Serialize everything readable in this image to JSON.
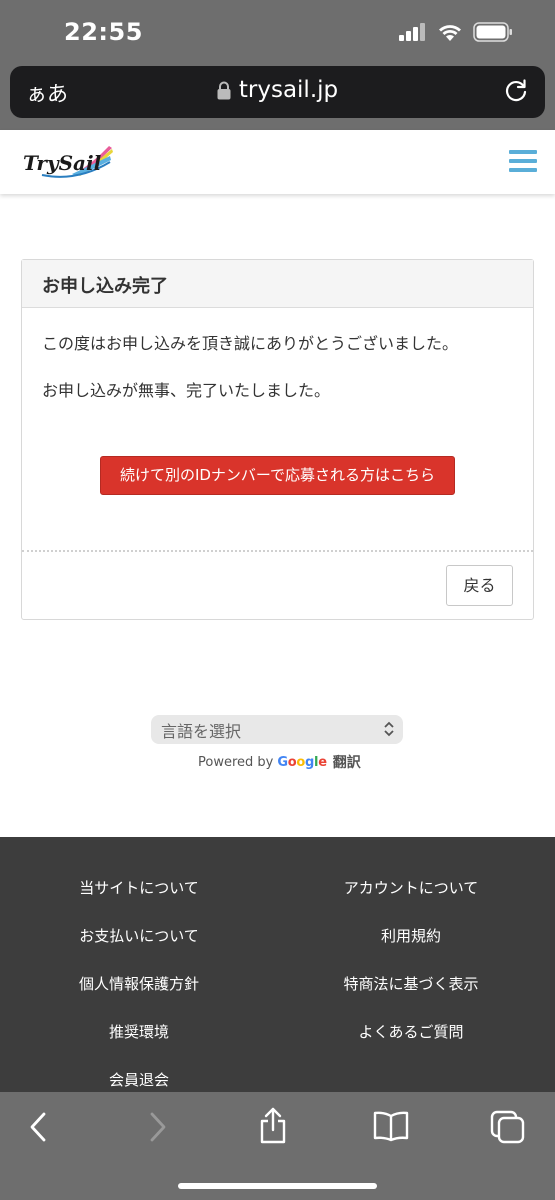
{
  "status_bar": {
    "time": "22:55"
  },
  "url_bar": {
    "aa_label": "ぁあ",
    "domain": "trysail.jp"
  },
  "header": {
    "logo_text": "TrySail"
  },
  "panel": {
    "heading": "お申し込み完了",
    "message1": "この度はお申し込みを頂き誠にありがとうございました。",
    "message2": "お申し込みが無事、完了いたしました。",
    "continue_button": "続けて別のIDナンバーで応募される方はこちら",
    "back_button": "戻る"
  },
  "translate": {
    "select_placeholder": "言語を選択",
    "powered_by": "Powered by",
    "google": "Google",
    "translate_label": "翻訳"
  },
  "footer": {
    "links": [
      "当サイトについて",
      "アカウントについて",
      "お支払いについて",
      "利用規約",
      "個人情報保護方針",
      "特商法に基づく表示",
      "推奨環境",
      "よくあるご質問",
      "会員退会"
    ]
  },
  "colors": {
    "accent_red": "#d9342b",
    "menu_blue": "#5aaed8",
    "footer_bg": "#3d3d3d",
    "chrome_gray": "#6e6e6e"
  }
}
